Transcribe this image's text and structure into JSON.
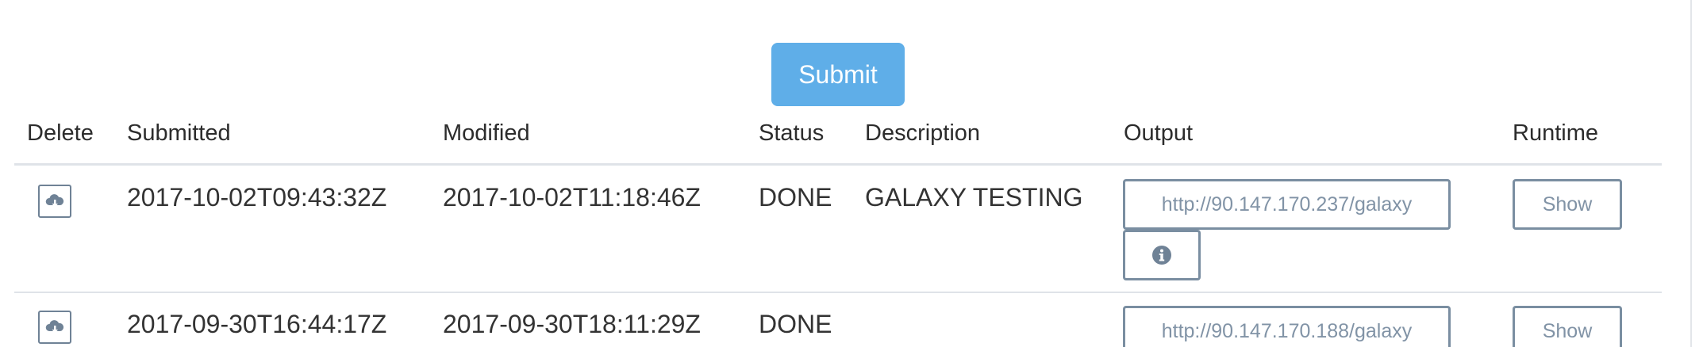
{
  "form": {
    "submit_label": "Submit"
  },
  "table": {
    "headers": {
      "delete": "Delete",
      "submitted": "Submitted",
      "modified": "Modified",
      "status": "Status",
      "description": "Description",
      "output": "Output",
      "runtime": "Runtime"
    },
    "rows": [
      {
        "submitted": "2017-10-02T09:43:32Z",
        "modified": "2017-10-02T11:18:46Z",
        "status": "DONE",
        "description": "GALAXY TESTING",
        "output": "http://90.147.170.237/galaxy",
        "runtime_label": "Show"
      },
      {
        "submitted": "2017-09-30T16:44:17Z",
        "modified": "2017-09-30T18:11:29Z",
        "status": "DONE",
        "description": "",
        "output": "http://90.147.170.188/galaxy",
        "runtime_label": "Show"
      }
    ]
  },
  "icons": {
    "delete": "cloud-download-icon",
    "info": "info-circle-icon"
  },
  "colors": {
    "submit_background": "#5faee8",
    "button_border": "#7a8ea1",
    "button_text": "#8193a6",
    "divider": "#dfe3e8"
  }
}
